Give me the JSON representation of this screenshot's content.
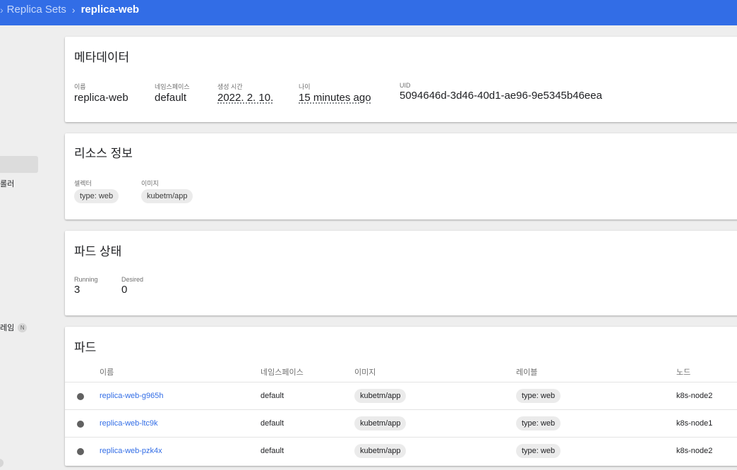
{
  "breadcrumb": {
    "parent": "Replica Sets",
    "current": "replica-web"
  },
  "sidenav": {
    "item_controller": "롤러",
    "item_frame": "레임",
    "badge_new": "N"
  },
  "metadata": {
    "title": "메타데이터",
    "name_label": "이름",
    "name_value": "replica-web",
    "namespace_label": "네임스페이스",
    "namespace_value": "default",
    "created_label": "생성 시간",
    "created_value": "2022. 2. 10.",
    "age_label": "나이",
    "age_value": "15 minutes ago",
    "uid_label": "UID",
    "uid_value": "5094646d-3d46-40d1-ae96-9e5345b46eea"
  },
  "resource": {
    "title": "리소스 정보",
    "selector_label": "셀렉터",
    "selector_value": "type: web",
    "image_label": "이미지",
    "image_value": "kubetm/app"
  },
  "pod_status": {
    "title": "파드 상태",
    "running_label": "Running",
    "running_value": "3",
    "desired_label": "Desired",
    "desired_value": "0"
  },
  "pods": {
    "title": "파드",
    "columns": {
      "name": "이름",
      "namespace": "네임스페이스",
      "image": "이미지",
      "labels": "레이블",
      "node": "노드"
    },
    "rows": [
      {
        "name": "replica-web-g965h",
        "namespace": "default",
        "image": "kubetm/app",
        "label": "type: web",
        "node": "k8s-node2"
      },
      {
        "name": "replica-web-ltc9k",
        "namespace": "default",
        "image": "kubetm/app",
        "label": "type: web",
        "node": "k8s-node1"
      },
      {
        "name": "replica-web-pzk4x",
        "namespace": "default",
        "image": "kubetm/app",
        "label": "type: web",
        "node": "k8s-node2"
      }
    ]
  },
  "colors": {
    "header_blue": "#326de6",
    "link_blue": "#326de6",
    "status_dot": "#616161"
  }
}
